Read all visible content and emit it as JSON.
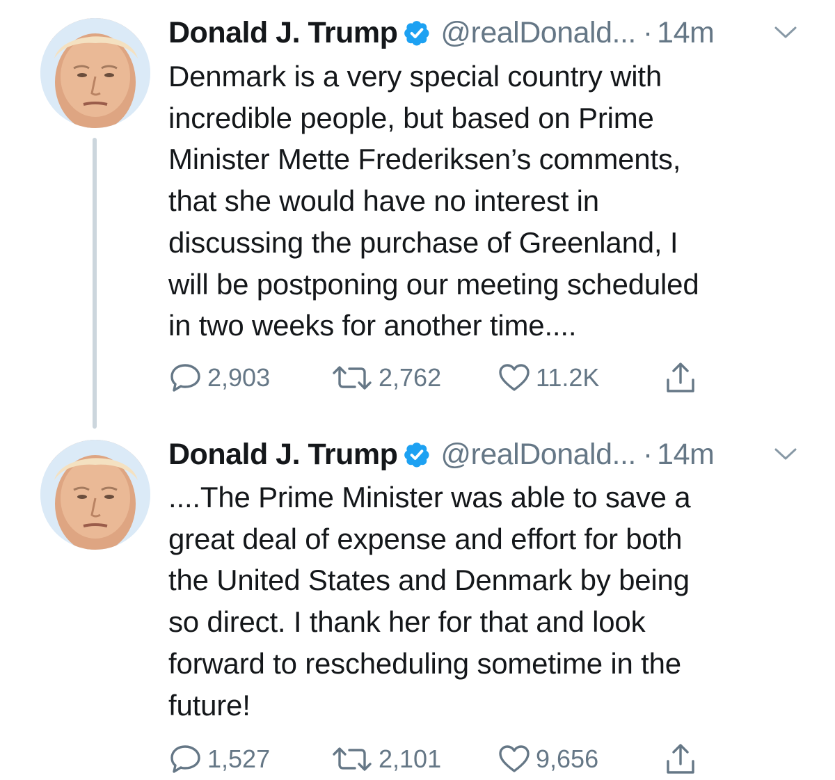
{
  "colors": {
    "text": "#14171a",
    "secondary": "#657786",
    "verified_blue": "#1da1f2",
    "thread_line": "#ccd6dd"
  },
  "tweets": [
    {
      "author_name": "Donald J. Trump",
      "handle": "@realDonald...",
      "separator": "·",
      "time": "14m",
      "text": "Denmark is a very special country with\nincredible people, but based on Prime\nMinister Mette Frederiksen’s comments,\nthat she would have no interest in\ndiscussing the purchase of Greenland, I\nwill be postponing our meeting scheduled\nin two weeks for another time....",
      "replies": "2,903",
      "retweets": "2,762",
      "likes": "11.2K",
      "icons": [
        "avatar",
        "verified-badge-icon",
        "chevron-down-icon",
        "reply-icon",
        "retweet-icon",
        "like-heart-icon",
        "share-icon"
      ]
    },
    {
      "author_name": "Donald J. Trump",
      "handle": "@realDonald...",
      "separator": "·",
      "time": "14m",
      "text": "....The Prime Minister was able to save a\ngreat deal of expense and effort for both\nthe United States and Denmark by being\nso direct. I thank her for that and look\nforward to rescheduling sometime in the\nfuture!",
      "replies": "1,527",
      "retweets": "2,101",
      "likes": "9,656",
      "icons": [
        "avatar",
        "verified-badge-icon",
        "chevron-down-icon",
        "reply-icon",
        "retweet-icon",
        "like-heart-icon",
        "share-icon"
      ]
    }
  ]
}
